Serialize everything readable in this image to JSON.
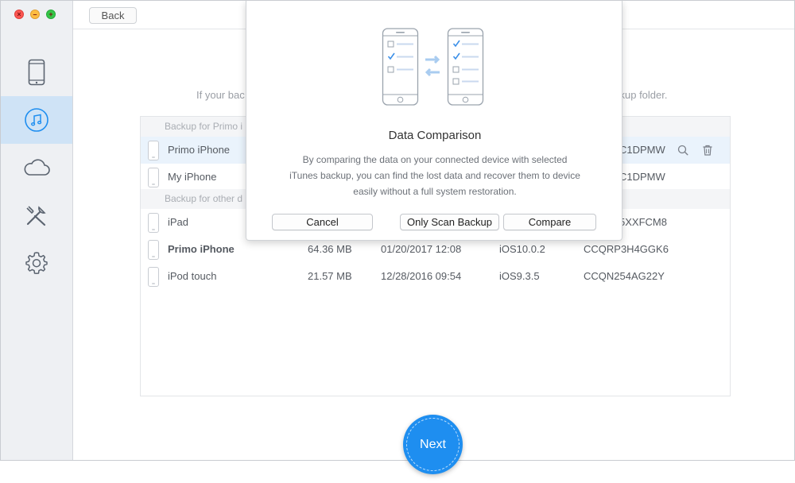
{
  "toolbar": {
    "back_label": "Back"
  },
  "instruction": {
    "left_text": "If your bac",
    "right_text": "ckup folder."
  },
  "sidebar": {
    "items": [
      {
        "icon": "iphone-icon",
        "active": false
      },
      {
        "icon": "itunes-music-icon",
        "active": true
      },
      {
        "icon": "icloud-icon",
        "active": false
      },
      {
        "icon": "tools-icon",
        "active": false
      },
      {
        "icon": "settings-gear-icon",
        "active": false
      }
    ]
  },
  "backups": {
    "group1_label": "Backup for Primo i",
    "group2_label": "Backup for other d",
    "group1_rows": [
      {
        "name": "Primo iPhone",
        "serial": "C1DPMW"
      },
      {
        "name": "My iPhone",
        "serial": "C1DPMW"
      }
    ],
    "group2_rows": [
      {
        "name": "iPad",
        "size": "",
        "date": "",
        "ios": "",
        "serial": "5XXFCM8"
      },
      {
        "name": "Primo iPhone",
        "size": "64.36 MB",
        "date": "01/20/2017 12:08",
        "ios": "iOS10.0.2",
        "serial": "CCQRP3H4GGK6"
      },
      {
        "name": "iPod touch",
        "size": "21.57 MB",
        "date": "12/28/2016 09:54",
        "ios": "iOS9.3.5",
        "serial": "CCQN254AG22Y"
      }
    ]
  },
  "modal": {
    "title": "Data Comparison",
    "description": "By comparing the data on your connected device with selected iTunes backup, you can find the lost data and recover them to device easily without a full system restoration.",
    "cancel_label": "Cancel",
    "scan_label": "Only Scan Backup",
    "compare_label": "Compare"
  },
  "next_label": "Next",
  "colors": {
    "accent": "#1e8ef0",
    "sidebar_active": "#cfe3f6",
    "selected_row": "#eaf3fc"
  }
}
